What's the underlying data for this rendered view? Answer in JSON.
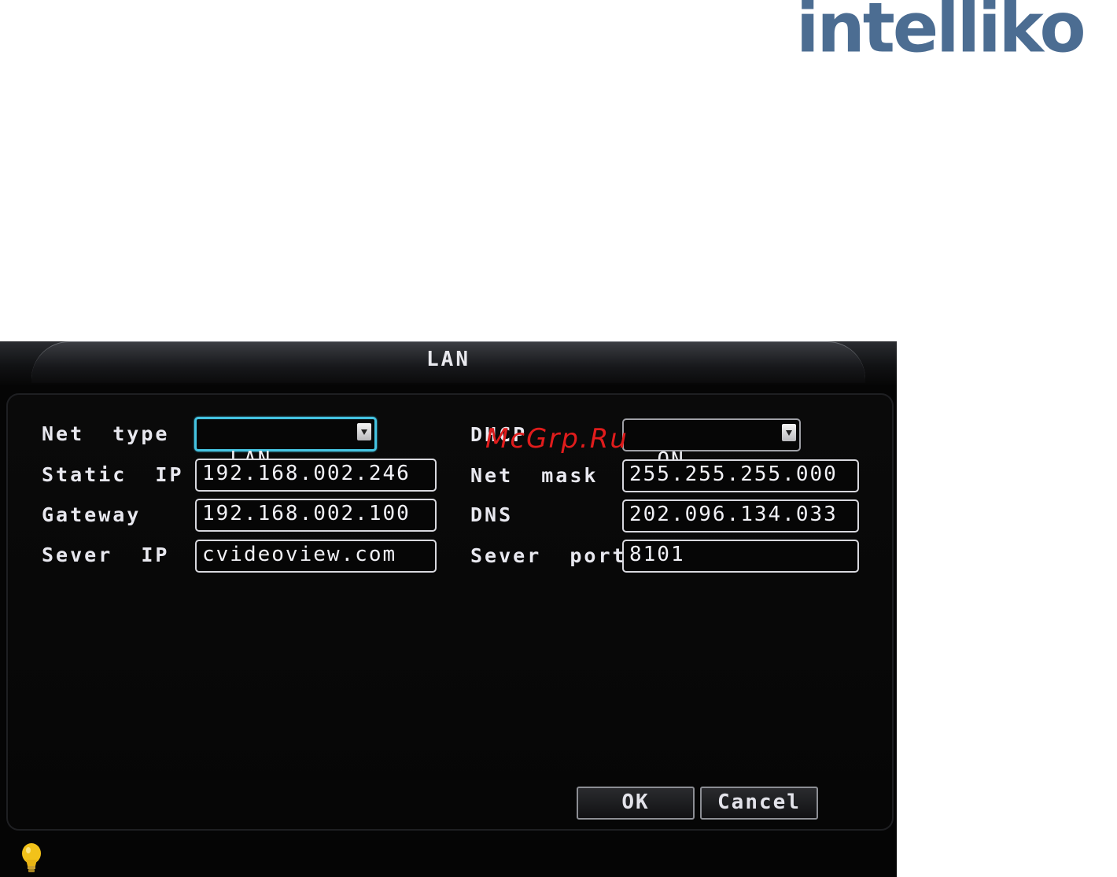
{
  "brand": {
    "logo_text": "intelliko"
  },
  "dialog": {
    "title": "LAN",
    "fields": {
      "net_type": {
        "label": "Net  type",
        "value": "LAN"
      },
      "static_ip": {
        "label": "Static  IP",
        "value": "192.168.002.246"
      },
      "gateway": {
        "label": "Gateway",
        "value": "192.168.002.100"
      },
      "server_ip": {
        "label": "Sever  IP",
        "value": "cvideoview.com"
      },
      "dhcp": {
        "label": "DHCP",
        "value": "ON"
      },
      "net_mask": {
        "label": "Net  mask",
        "value": "255.255.255.000"
      },
      "dns": {
        "label": "DNS",
        "value": "202.096.134.033"
      },
      "server_port": {
        "label": "Sever  port",
        "value": "8101"
      }
    },
    "buttons": {
      "ok": "OK",
      "cancel": "Cancel"
    }
  },
  "watermark": "McGrp.Ru",
  "icons": {
    "status": "lightbulb-icon",
    "dropdown": "chevron-down-icon"
  },
  "colors": {
    "logo": "#4c6d92",
    "focus": "#44c3e1",
    "watermark": "#e01c1c"
  }
}
